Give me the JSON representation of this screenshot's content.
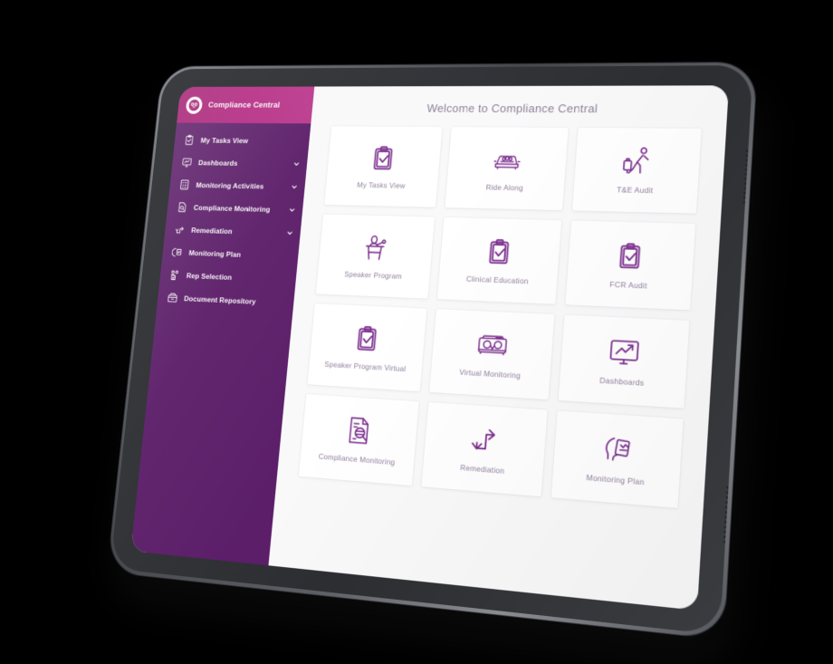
{
  "brand": {
    "name": "Compliance Central",
    "logo_icon": "owl-circle-logo-icon",
    "header_color": "#b52a83",
    "sidebar_color": "#5c1e69"
  },
  "sidebar": {
    "items": [
      {
        "label": "My Tasks View",
        "icon": "clipboard-check-icon",
        "expandable": false
      },
      {
        "label": "Dashboards",
        "icon": "dashboard-monitor-icon",
        "expandable": true
      },
      {
        "label": "Monitoring Activities",
        "icon": "checklist-icon",
        "expandable": true
      },
      {
        "label": "Compliance Monitoring",
        "icon": "document-search-icon",
        "expandable": true
      },
      {
        "label": "Remediation",
        "icon": "exchange-arrows-icon",
        "expandable": true
      },
      {
        "label": "Monitoring Plan",
        "icon": "plan-hand-icon",
        "expandable": false
      },
      {
        "label": "Rep Selection",
        "icon": "people-select-icon",
        "expandable": false
      },
      {
        "label": "Document Repository",
        "icon": "archive-box-icon",
        "expandable": false
      }
    ],
    "chevron_icon": "chevron-down-icon"
  },
  "main": {
    "title": "Welcome to Compliance Central",
    "accent_color": "#7b2d8e",
    "label_color": "#8f7f9c",
    "cards": [
      {
        "label": "My Tasks View",
        "icon": "clipboard-check-icon"
      },
      {
        "label": "Ride Along",
        "icon": "car-icon"
      },
      {
        "label": "T&E Audit",
        "icon": "traveler-luggage-icon"
      },
      {
        "label": "Speaker Program",
        "icon": "podium-speaker-icon"
      },
      {
        "label": "Clinical Education",
        "icon": "clipboard-check-icon"
      },
      {
        "label": "FCR Audit",
        "icon": "clipboard-check-icon"
      },
      {
        "label": "Speaker Program Virtual",
        "icon": "clipboard-check-icon"
      },
      {
        "label": "Virtual Monitoring",
        "icon": "vr-headset-icon"
      },
      {
        "label": "Dashboards",
        "icon": "monitor-chart-icon"
      },
      {
        "label": "Compliance Monitoring",
        "icon": "document-magnifier-icon"
      },
      {
        "label": "Remediation",
        "icon": "exchange-arrows-icon"
      },
      {
        "label": "Monitoring Plan",
        "icon": "plan-hand-icon"
      }
    ]
  },
  "device": {
    "type": "tablet",
    "bezel_color": "#34363a",
    "rim_color": "#6d7075"
  }
}
